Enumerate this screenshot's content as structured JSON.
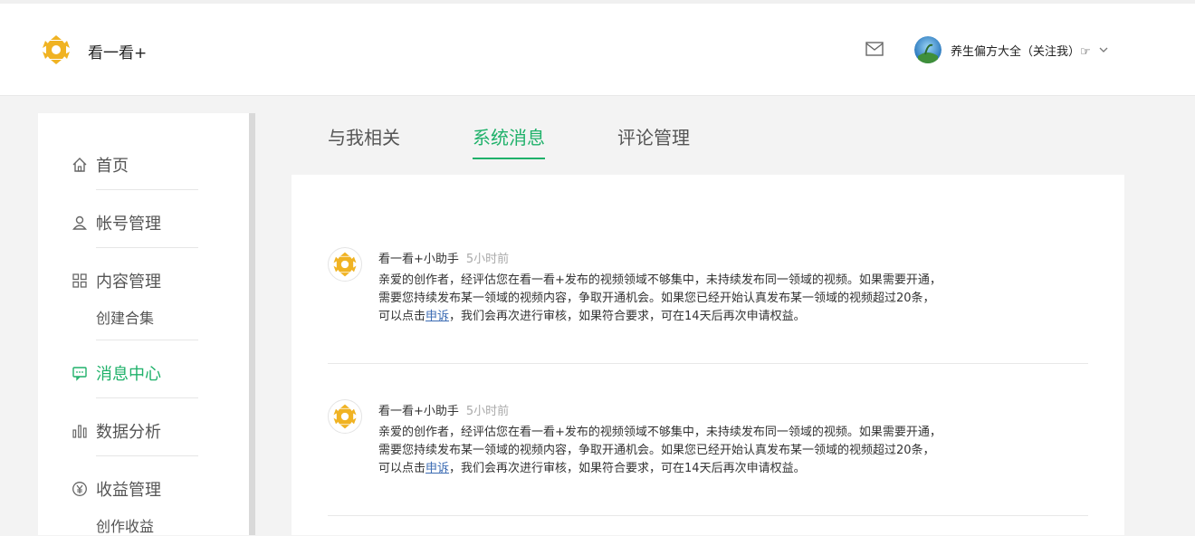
{
  "header": {
    "app_name": "看一看+",
    "username": "养生偏方大全（关注我）☞",
    "icons": {
      "logo": "star-flower-logo",
      "mail": "mail-icon",
      "chevron": "chevron-down-icon"
    }
  },
  "sidebar": {
    "items": [
      {
        "label": "首页",
        "icon": "home-icon"
      },
      {
        "label": "帐号管理",
        "icon": "user-icon"
      },
      {
        "label": "内容管理",
        "icon": "grid-icon"
      },
      {
        "label": "消息中心",
        "icon": "message-icon",
        "active": true
      },
      {
        "label": "数据分析",
        "icon": "bar-chart-icon"
      },
      {
        "label": "收益管理",
        "icon": "yen-icon"
      }
    ],
    "subitems": {
      "content": "创建合集",
      "earnings": "创作收益"
    }
  },
  "tabs": [
    {
      "label": "与我相关",
      "active": false
    },
    {
      "label": "系统消息",
      "active": true
    },
    {
      "label": "评论管理",
      "active": false
    }
  ],
  "messages": [
    {
      "sender": "看一看+小助手",
      "time": "5小时前",
      "line1": "亲爱的创作者，经评估您在看一看+发布的视频领域不够集中，未持续发布同一领域的视频。如果需要开通，",
      "line2": "需要您持续发布某一领域的视频内容，争取开通机会。如果您已经开始认真发布某一领域的视频超过20条，",
      "line3_pre": "可以点击",
      "link": "申诉",
      "line3_post": "，我们会再次进行审核，如果符合要求，可在14天后再次申请权益。"
    },
    {
      "sender": "看一看+小助手",
      "time": "5小时前",
      "line1": "亲爱的创作者，经评估您在看一看+发布的视频领域不够集中，未持续发布同一领域的视频。如果需要开通，",
      "line2": "需要您持续发布某一领域的视频内容，争取开通机会。如果您已经开始认真发布某一领域的视频超过20条，",
      "line3_pre": "可以点击",
      "link": "申诉",
      "line3_post": "，我们会再次进行审核，如果符合要求，可在14天后再次申请权益。"
    }
  ],
  "colors": {
    "accent": "#1fb16a",
    "logo": "#f0b323",
    "link": "#3b6bb3"
  }
}
